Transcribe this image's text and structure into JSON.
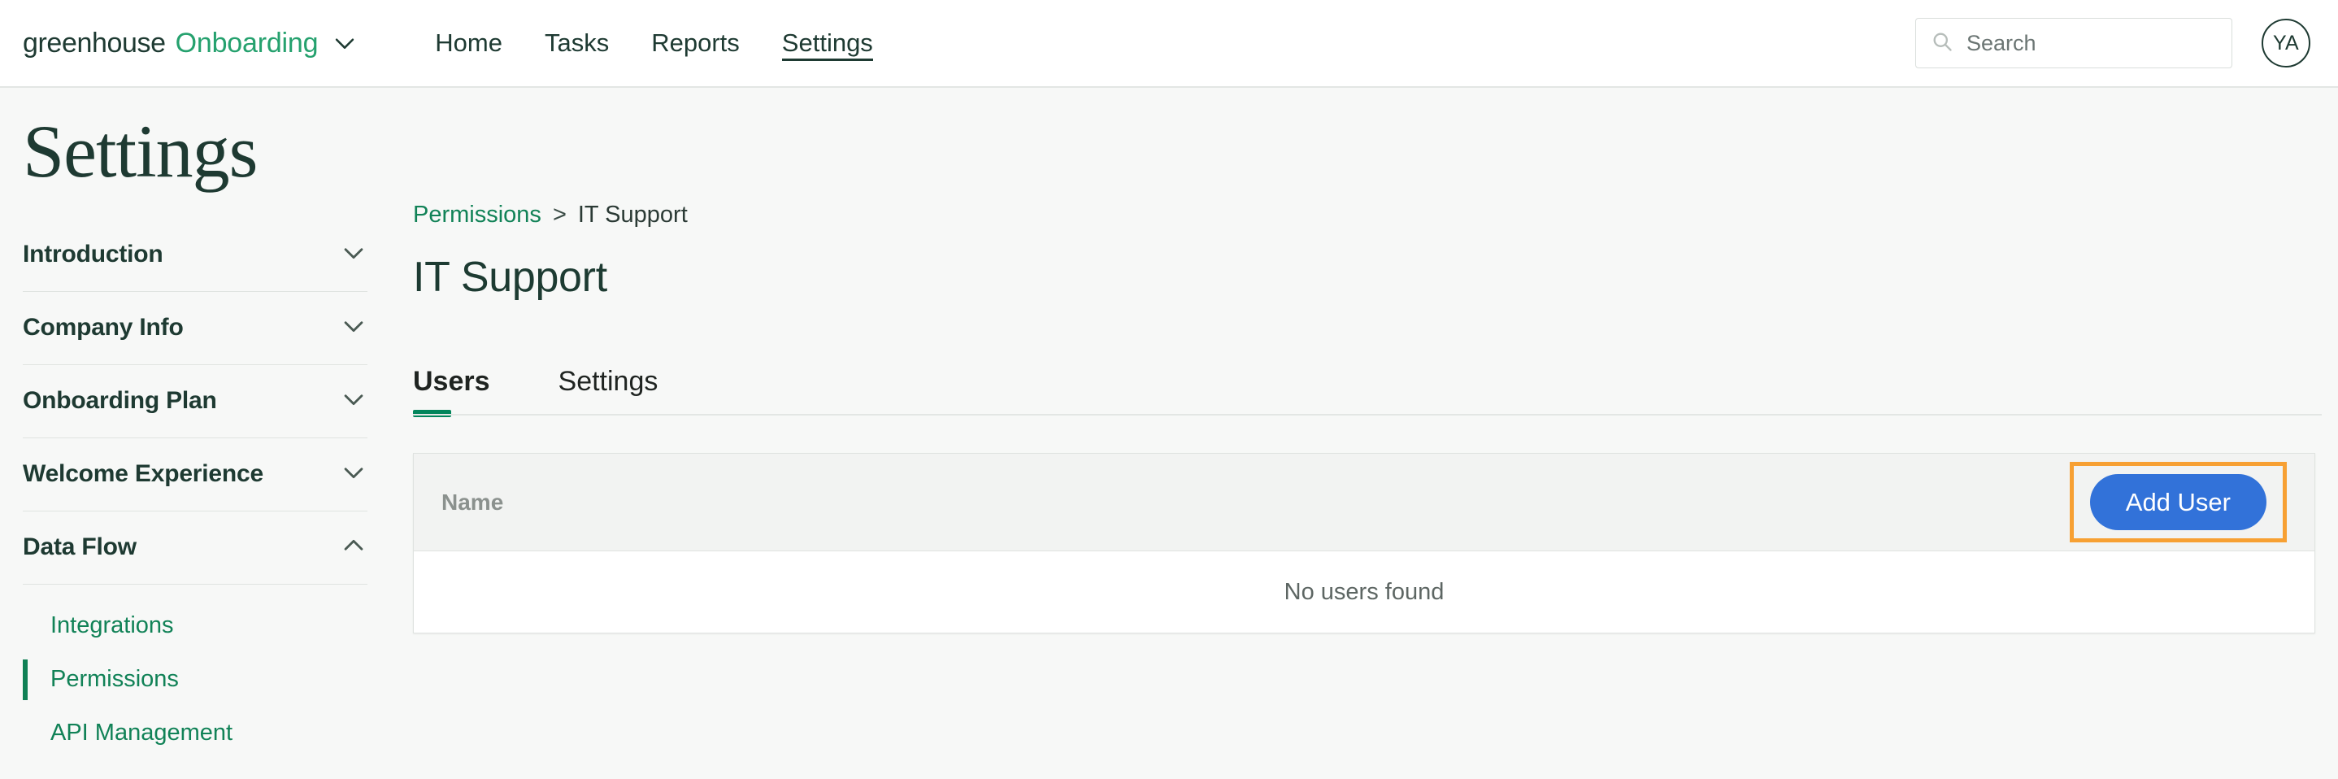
{
  "header": {
    "brand": {
      "company": "greenhouse",
      "product": "Onboarding",
      "caret_icon": "chevron-down-icon"
    },
    "nav": [
      {
        "label": "Home",
        "active": false
      },
      {
        "label": "Tasks",
        "active": false
      },
      {
        "label": "Reports",
        "active": false
      },
      {
        "label": "Settings",
        "active": true
      }
    ],
    "search": {
      "placeholder": "Search",
      "icon": "search-icon",
      "value": ""
    },
    "avatar": {
      "initials": "YA"
    }
  },
  "sidebar": {
    "title": "Settings",
    "sections": [
      {
        "label": "Introduction",
        "expanded": false,
        "chevron": "chevron-down-icon"
      },
      {
        "label": "Company Info",
        "expanded": false,
        "chevron": "chevron-down-icon"
      },
      {
        "label": "Onboarding Plan",
        "expanded": false,
        "chevron": "chevron-down-icon"
      },
      {
        "label": "Welcome Experience",
        "expanded": false,
        "chevron": "chevron-down-icon"
      },
      {
        "label": "Data Flow",
        "expanded": true,
        "chevron": "chevron-up-icon"
      }
    ],
    "sub_items": [
      {
        "label": "Integrations",
        "active": false
      },
      {
        "label": "Permissions",
        "active": true
      },
      {
        "label": "API Management",
        "active": false
      }
    ]
  },
  "main": {
    "breadcrumb": {
      "parent": "Permissions",
      "separator": ">",
      "current": "IT Support"
    },
    "title": "IT Support",
    "tabs": [
      {
        "label": "Users",
        "active": true
      },
      {
        "label": "Settings",
        "active": false
      }
    ],
    "table": {
      "columns": [
        "Name"
      ],
      "rows": [],
      "empty_message": "No users found",
      "add_button": "Add User"
    }
  },
  "colors": {
    "brand_dark_green": "#1e3a32",
    "brand_green": "#25a16e",
    "link_green": "#118257",
    "tab_indicator": "#02855b",
    "primary_button": "#3272d9",
    "highlight_orange": "#f7a033",
    "page_background": "#f7f8f7"
  }
}
